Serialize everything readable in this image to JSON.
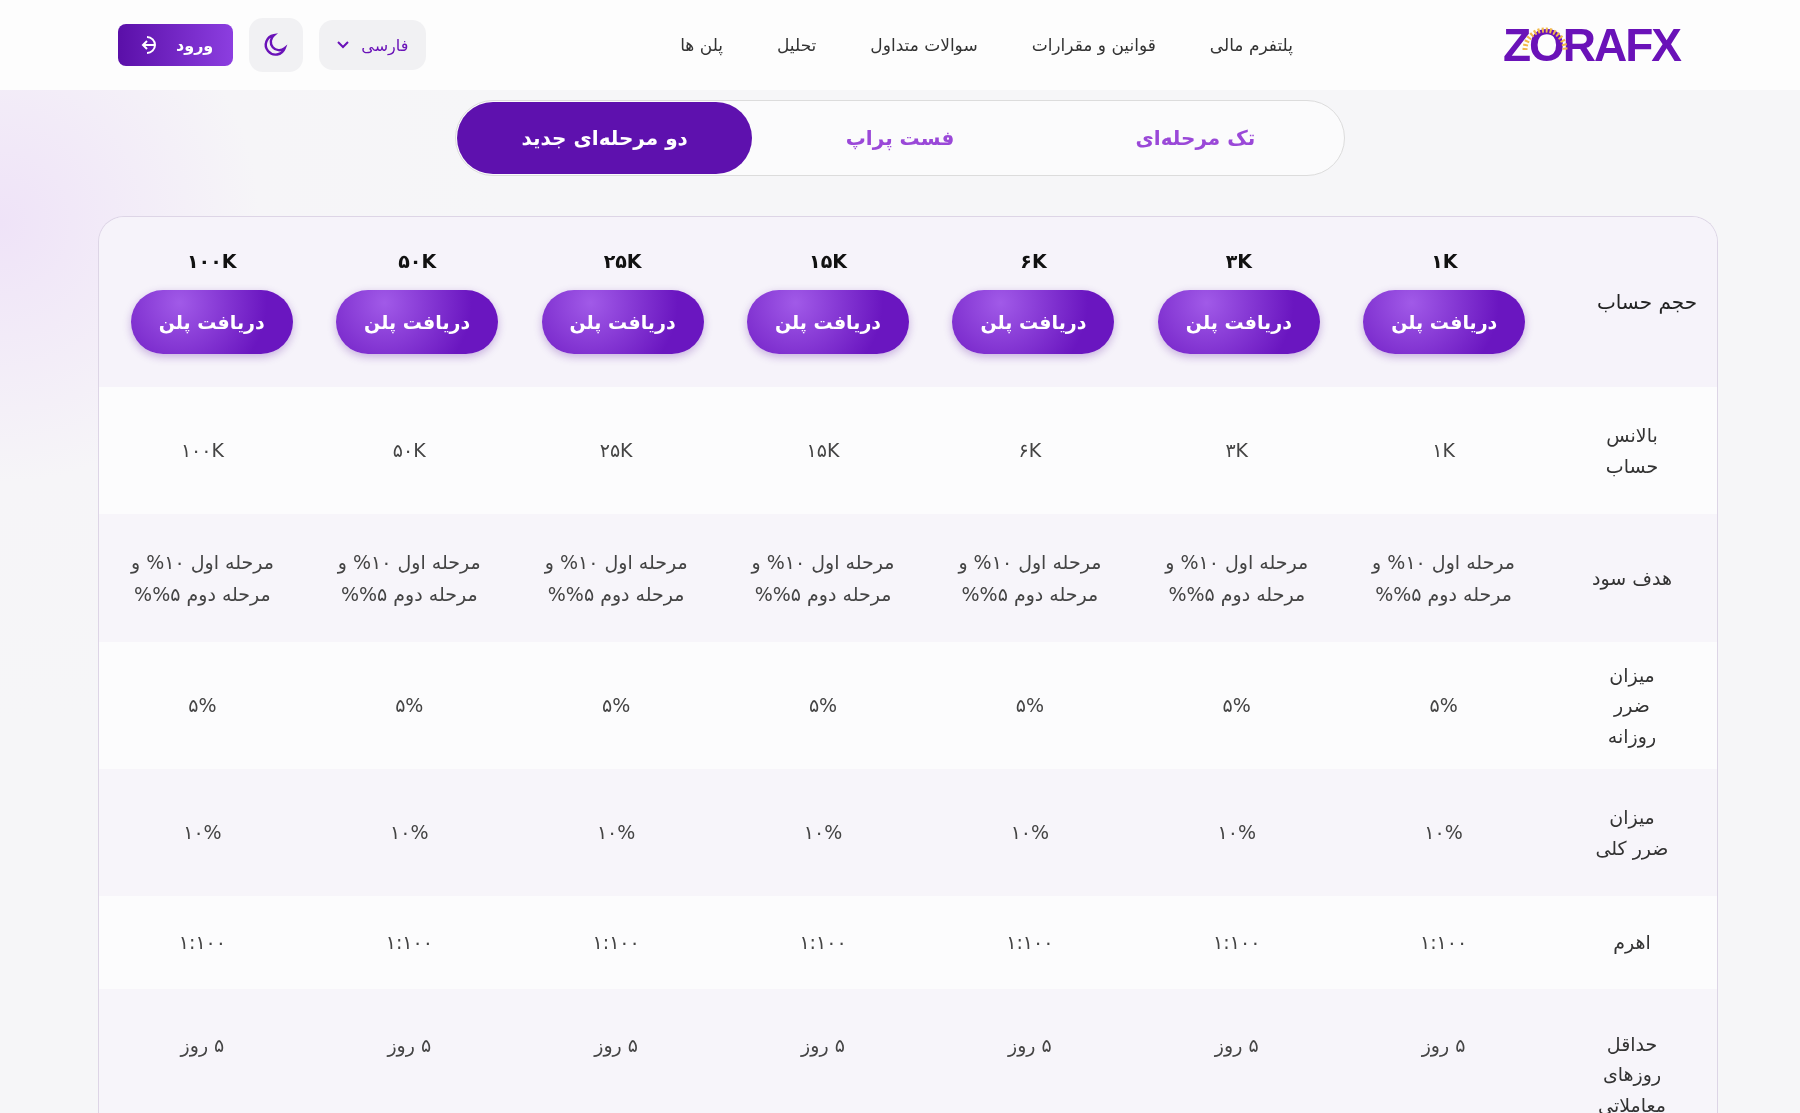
{
  "header": {
    "logo": "ZORAFX",
    "nav": [
      "پلتفرم مالی",
      "قوانین و مقرارات",
      "سوالات متداول",
      "تحلیل",
      "پلن ها"
    ],
    "language": "فارسی",
    "login": "ورود"
  },
  "tabs": [
    {
      "label": "تک مرحله‌ای",
      "selected": false
    },
    {
      "label": "فست پراپ",
      "selected": false
    },
    {
      "label": "دو مرحله‌ای جدید",
      "selected": true
    }
  ],
  "table": {
    "header_label": "حجم حساب",
    "sizes": [
      {
        "size": "۱K",
        "button": "دریافت پلن"
      },
      {
        "size": "۳K",
        "button": "دریافت پلن"
      },
      {
        "size": "۶K",
        "button": "دریافت پلن"
      },
      {
        "size": "۱۵K",
        "button": "دریافت پلن"
      },
      {
        "size": "۲۵K",
        "button": "دریافت پلن"
      },
      {
        "size": "۵۰K",
        "button": "دریافت پلن"
      },
      {
        "size": "۱۰۰K",
        "button": "دریافت پلن"
      }
    ],
    "rows": [
      {
        "label": "بالانس حساب",
        "values": [
          "۱K",
          "۳K",
          "۶K",
          "۱۵K",
          "۲۵K",
          "۵۰K",
          "۱۰۰K"
        ]
      },
      {
        "label": "هدف سود",
        "values": [
          "مرحله اول ۱۰% و مرحله دوم ۵%%",
          "مرحله اول ۱۰% و مرحله دوم ۵%%",
          "مرحله اول ۱۰% و مرحله دوم ۵%%",
          "مرحله اول ۱۰% و مرحله دوم ۵%%",
          "مرحله اول ۱۰% و مرحله دوم ۵%%",
          "مرحله اول ۱۰% و مرحله دوم ۵%%",
          "مرحله اول ۱۰% و مرحله دوم ۵%%"
        ]
      },
      {
        "label": "میزان ضرر روزانه",
        "values": [
          "۵%",
          "۵%",
          "۵%",
          "۵%",
          "۵%",
          "۵%",
          "۵%"
        ]
      },
      {
        "label": "میزان ضرر کلی",
        "values": [
          "۱۰%",
          "۱۰%",
          "۱۰%",
          "۱۰%",
          "۱۰%",
          "۱۰%",
          "۱۰%"
        ]
      },
      {
        "label": "اهرم",
        "values": [
          "۱:۱۰۰",
          "۱:۱۰۰",
          "۱:۱۰۰",
          "۱:۱۰۰",
          "۱:۱۰۰",
          "۱:۱۰۰",
          "۱:۱۰۰"
        ]
      },
      {
        "label": "حداقل روزهای معاملاتی",
        "values": [
          "۵ روز",
          "۵ روز",
          "۵ روز",
          "۵ روز",
          "۵ روز",
          "۵ روز",
          "۵ روز"
        ]
      }
    ]
  }
}
